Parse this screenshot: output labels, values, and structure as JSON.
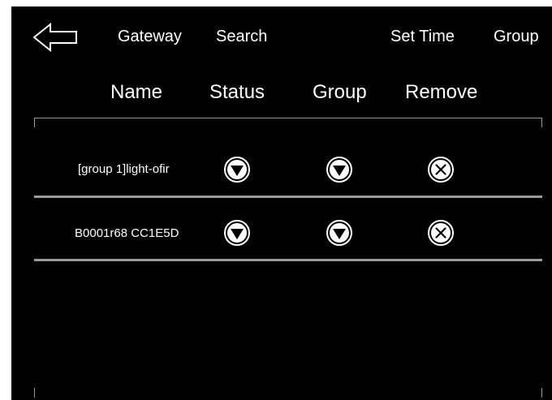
{
  "topbar": {
    "back_icon": "back-arrow-icon",
    "nav": [
      "Gateway",
      "Search",
      "Set Time",
      "Group"
    ]
  },
  "columns": [
    "Name",
    "Status",
    "Group",
    "Remove"
  ],
  "rows": [
    {
      "name": "[group 1]light-ofir"
    },
    {
      "name": "B0001r68 CC1E5D"
    }
  ],
  "icons": {
    "status": "dropdown-icon",
    "group": "dropdown-icon",
    "remove": "remove-x-icon"
  },
  "colors": {
    "background": "#000000",
    "text": "#ffffff",
    "divider": "#9a9a9a"
  }
}
